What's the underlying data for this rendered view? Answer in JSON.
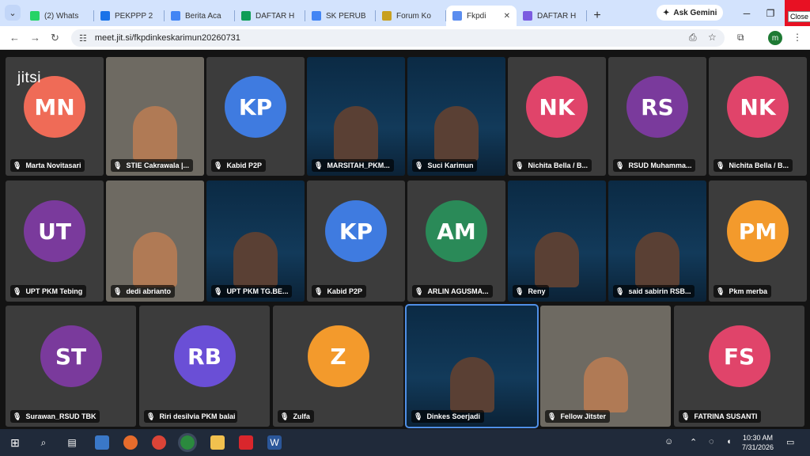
{
  "browser": {
    "tabs": [
      {
        "title": "(2) Whats",
        "color": "#25d366",
        "active": false
      },
      {
        "title": "PEKPPP 2",
        "color": "#1a73e8",
        "active": false
      },
      {
        "title": "Berita Aca",
        "color": "#4285f4",
        "active": false
      },
      {
        "title": "DAFTAR H",
        "color": "#0f9d58",
        "active": false
      },
      {
        "title": "SK PERUB",
        "color": "#4285f4",
        "active": false
      },
      {
        "title": "Forum Ko",
        "color": "#c8a020",
        "active": false
      },
      {
        "title": "Fkpdi",
        "color": "#5b8def",
        "active": true
      },
      {
        "title": "DAFTAR H",
        "color": "#7b5ce0",
        "active": false
      }
    ],
    "gemini_label": "Ask Gemini",
    "close_tooltip": "Close",
    "url": "meet.jit.si/fkpdinkeskarimun20260731",
    "profile_initial": "m"
  },
  "meeting": {
    "brand": "jitsi",
    "tiles": [
      {
        "name": "Marta Novitasari",
        "initials": "MN",
        "color": "#ef6b57",
        "kind": "avatar"
      },
      {
        "name": "STIE Cakrawala |...",
        "initials": "",
        "color": "",
        "kind": "video-person"
      },
      {
        "name": "Kabid P2P",
        "initials": "KP",
        "color": "#3f7be0",
        "kind": "avatar"
      },
      {
        "name": "MARSITAH_PKM...",
        "initials": "",
        "color": "",
        "kind": "video-slide"
      },
      {
        "name": "Suci Karimun",
        "initials": "",
        "color": "",
        "kind": "video-slide"
      },
      {
        "name": "Nichita Bella / B...",
        "initials": "NK",
        "color": "#e0446a",
        "kind": "avatar"
      },
      {
        "name": "RSUD Muhamma...",
        "initials": "RS",
        "color": "#7a3a9c",
        "kind": "avatar"
      },
      {
        "name": "Nichita Bella / B...",
        "initials": "NK",
        "color": "#e0446a",
        "kind": "avatar"
      },
      {
        "name": "UPT PKM Tebing",
        "initials": "UT",
        "color": "#7a3a9c",
        "kind": "avatar"
      },
      {
        "name": "dedi abrianto",
        "initials": "",
        "color": "",
        "kind": "video-person"
      },
      {
        "name": "UPT PKM TG.BE...",
        "initials": "",
        "color": "",
        "kind": "video-slide"
      },
      {
        "name": "Kabid P2P",
        "initials": "KP",
        "color": "#3f7be0",
        "kind": "avatar"
      },
      {
        "name": "ARLIN AGUSMA...",
        "initials": "AM",
        "color": "#2a8a58",
        "kind": "avatar"
      },
      {
        "name": "Reny",
        "initials": "",
        "color": "",
        "kind": "video-slide"
      },
      {
        "name": "said sabirin RSB...",
        "initials": "",
        "color": "",
        "kind": "video-slide"
      },
      {
        "name": "Pkm merba",
        "initials": "PM",
        "color": "#f39a2c",
        "kind": "avatar"
      },
      {
        "name": "Surawan_RSUD TBK",
        "initials": "ST",
        "color": "#7a3a9c",
        "kind": "avatar"
      },
      {
        "name": "Riri desilvia PKM balai",
        "initials": "RB",
        "color": "#6a4fd6",
        "kind": "avatar"
      },
      {
        "name": "Zulfa",
        "initials": "Z",
        "color": "#f39a2c",
        "kind": "avatar"
      },
      {
        "name": "Dinkes Soerjadi",
        "initials": "",
        "color": "",
        "kind": "video-slide"
      },
      {
        "name": "Fellow Jitster",
        "initials": "",
        "color": "",
        "kind": "video-person"
      },
      {
        "name": "FATRINA SUSANTI",
        "initials": "FS",
        "color": "#e0446a",
        "kind": "avatar"
      }
    ]
  },
  "taskbar": {
    "time": "10:30 AM",
    "date": "7/31/2026"
  }
}
